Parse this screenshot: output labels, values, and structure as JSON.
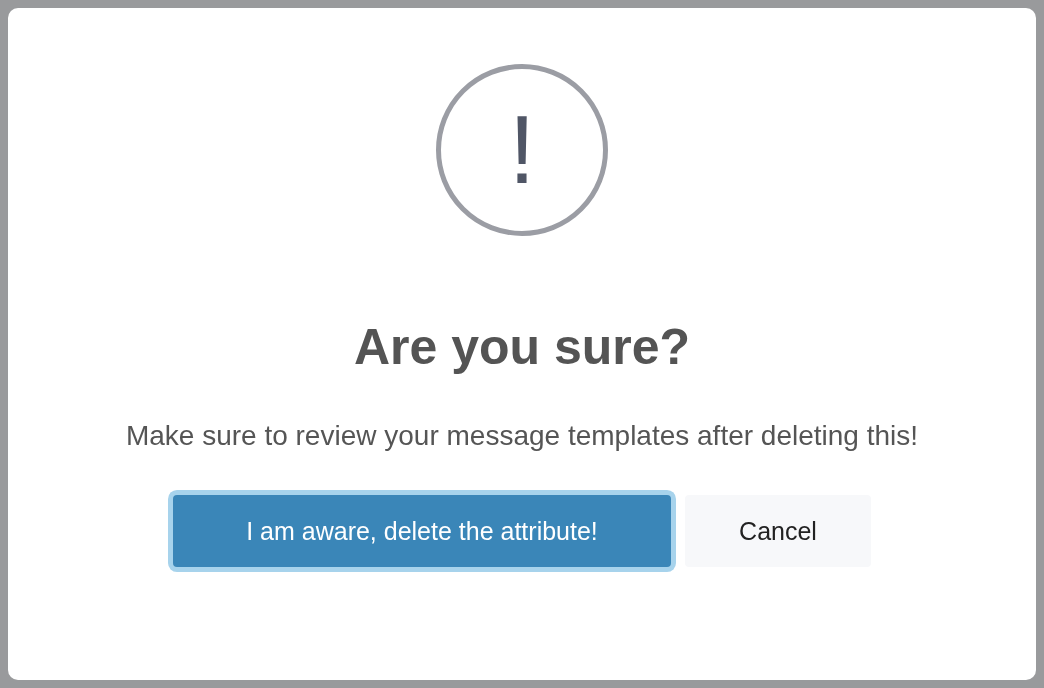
{
  "dialog": {
    "icon": "!",
    "title": "Are you sure?",
    "message": "Make sure to review your message templates after deleting this!",
    "buttons": [
      {
        "label": "I am aware, delete the attribute!",
        "kind": "confirm",
        "focused": true
      },
      {
        "label": "Cancel",
        "kind": "cancel",
        "focused": false
      }
    ]
  }
}
